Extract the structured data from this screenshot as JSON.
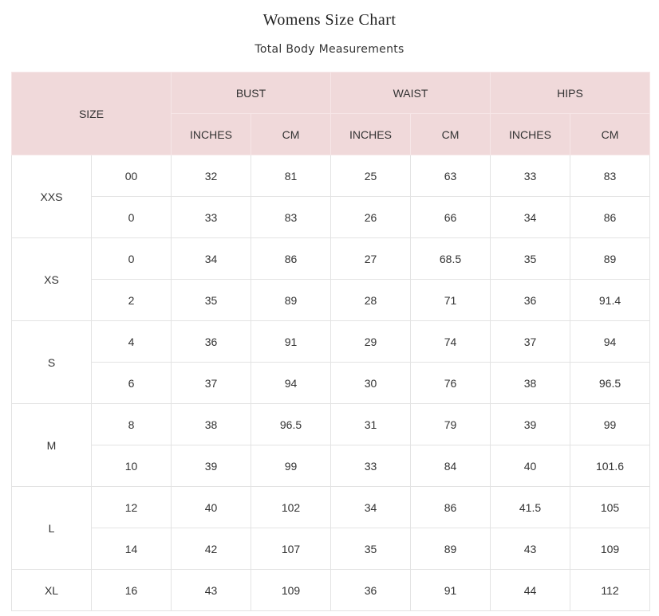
{
  "title": "Womens Size Chart",
  "subtitle": "Total Body Measurements",
  "header": {
    "size": "SIZE",
    "groups": [
      "BUST",
      "WAIST",
      "HIPS"
    ],
    "units": [
      "INCHES",
      "CM",
      "INCHES",
      "CM",
      "INCHES",
      "CM"
    ]
  },
  "groups": [
    {
      "size": "XXS",
      "rows": [
        {
          "num": "00",
          "values": [
            "32",
            "81",
            "25",
            "63",
            "33",
            "83"
          ]
        },
        {
          "num": "0",
          "values": [
            "33",
            "83",
            "26",
            "66",
            "34",
            "86"
          ]
        }
      ]
    },
    {
      "size": "XS",
      "rows": [
        {
          "num": "0",
          "values": [
            "34",
            "86",
            "27",
            "68.5",
            "35",
            "89"
          ]
        },
        {
          "num": "2",
          "values": [
            "35",
            "89",
            "28",
            "71",
            "36",
            "91.4"
          ]
        }
      ]
    },
    {
      "size": "S",
      "rows": [
        {
          "num": "4",
          "values": [
            "36",
            "91",
            "29",
            "74",
            "37",
            "94"
          ]
        },
        {
          "num": "6",
          "values": [
            "37",
            "94",
            "30",
            "76",
            "38",
            "96.5"
          ]
        }
      ]
    },
    {
      "size": "M",
      "rows": [
        {
          "num": "8",
          "values": [
            "38",
            "96.5",
            "31",
            "79",
            "39",
            "99"
          ]
        },
        {
          "num": "10",
          "values": [
            "39",
            "99",
            "33",
            "84",
            "40",
            "101.6"
          ]
        }
      ]
    },
    {
      "size": "L",
      "rows": [
        {
          "num": "12",
          "values": [
            "40",
            "102",
            "34",
            "86",
            "41.5",
            "105"
          ]
        },
        {
          "num": "14",
          "values": [
            "42",
            "107",
            "35",
            "89",
            "43",
            "109"
          ]
        }
      ]
    },
    {
      "size": "XL",
      "rows": [
        {
          "num": "16",
          "values": [
            "43",
            "109",
            "36",
            "91",
            "44",
            "112"
          ]
        }
      ]
    }
  ]
}
